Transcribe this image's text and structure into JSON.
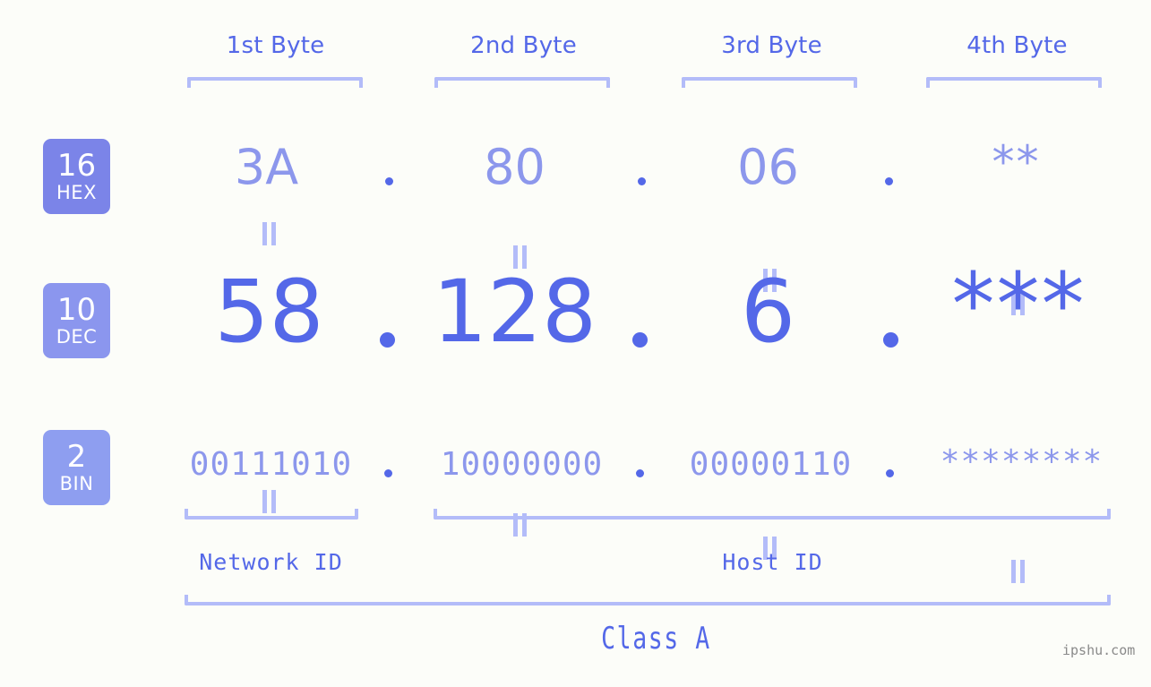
{
  "page": {
    "background_color": "#fcfdf9",
    "accent_strong": "#5468e8",
    "accent_mid": "#8c97ec",
    "accent_light": "#b3bcf9",
    "watermark": "ipshu.com"
  },
  "byte_headers": [
    {
      "label": "1st Byte"
    },
    {
      "label": "2nd Byte"
    },
    {
      "label": "3rd Byte"
    },
    {
      "label": "4th Byte"
    }
  ],
  "bases": [
    {
      "num": "16",
      "name": "HEX",
      "color": "#7b84e8"
    },
    {
      "num": "10",
      "name": "DEC",
      "color": "#8b96ee"
    },
    {
      "num": "2",
      "name": "BIN",
      "color": "#8e9ef0"
    }
  ],
  "rows": {
    "hex": {
      "base_num": "16",
      "base_name": "HEX",
      "values": [
        "3A",
        "80",
        "06",
        "**"
      ],
      "separators": [
        ".",
        ".",
        "."
      ]
    },
    "dec": {
      "base_num": "10",
      "base_name": "DEC",
      "values": [
        "58",
        "128",
        "6",
        "***"
      ],
      "separators": [
        ".",
        ".",
        "."
      ]
    },
    "bin": {
      "base_num": "2",
      "base_name": "BIN",
      "values": [
        "00111010",
        "10000000",
        "00000110",
        "********"
      ],
      "separators": [
        ".",
        ".",
        "."
      ]
    }
  },
  "equals_symbol": "=",
  "footer": {
    "network_id_label": "Network ID",
    "host_id_label": "Host ID",
    "class_label": "Class A"
  }
}
